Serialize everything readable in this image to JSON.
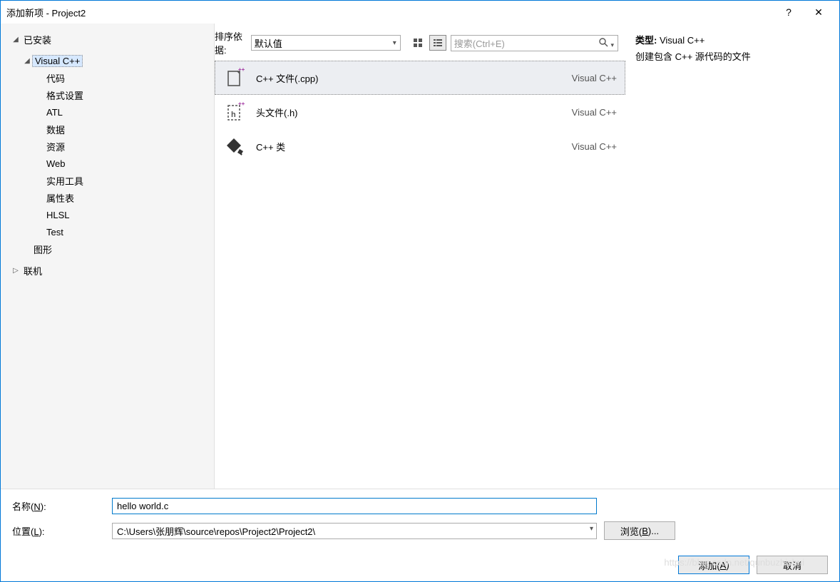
{
  "window": {
    "title": "添加新项 - Project2",
    "help": "?",
    "close": "✕"
  },
  "tree": {
    "installed": "已安装",
    "vcpp": "Visual C++",
    "items": [
      "代码",
      "格式设置",
      "ATL",
      "数据",
      "资源",
      "Web",
      "实用工具",
      "属性表",
      "HLSL",
      "Test"
    ],
    "graphics": "图形",
    "online": "联机"
  },
  "center": {
    "sort_label": "排序依据:",
    "sort_value": "默认值",
    "search_placeholder": "搜索(Ctrl+E)"
  },
  "templates": [
    {
      "name": "C++ 文件(.cpp)",
      "cat": "Visual C++",
      "icon": "cpp-file"
    },
    {
      "name": "头文件(.h)",
      "cat": "Visual C++",
      "icon": "h-file"
    },
    {
      "name": "C++ 类",
      "cat": "Visual C++",
      "icon": "cpp-class"
    }
  ],
  "details": {
    "type_label": "类型:",
    "type_value": "Visual C++",
    "description": "创建包含 C++ 源代码的文件"
  },
  "form": {
    "name_label": "名称(N):",
    "name_value": "hello world.c",
    "location_label": "位置(L):",
    "location_value": "C:\\Users\\张朋辉\\source\\repos\\Project2\\Project2\\",
    "browse": "浏览(B)...",
    "add": "添加(A)",
    "cancel": "取消"
  },
  "watermark": "https://blog.csdn.net/qunbuzhishui"
}
